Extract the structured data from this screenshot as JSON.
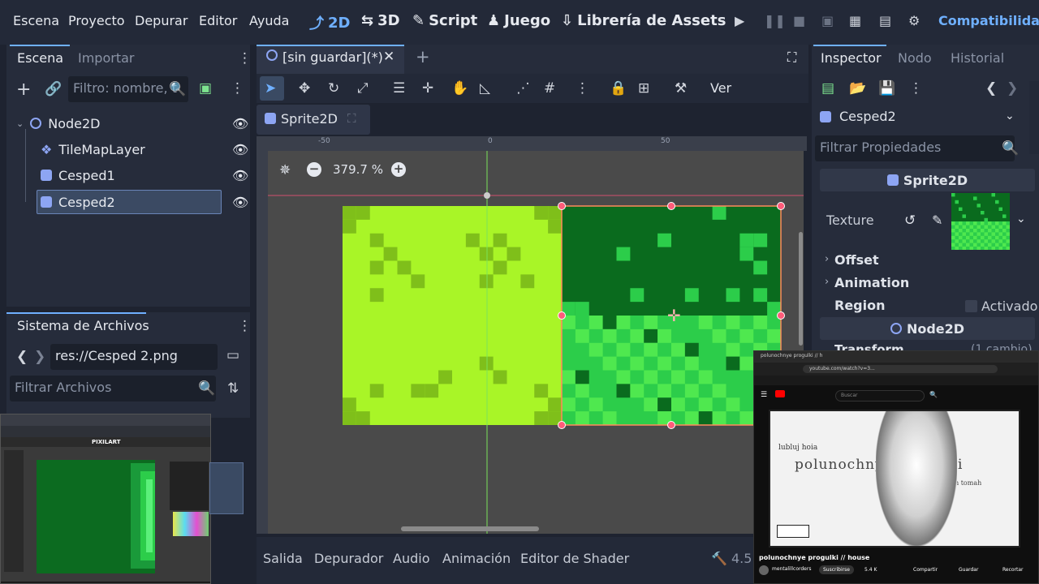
{
  "menu": [
    "Escena",
    "Proyecto",
    "Depurar",
    "Editor",
    "Ayuda"
  ],
  "workspaces": [
    {
      "label": "2D",
      "icon": "2d-icon",
      "active": true
    },
    {
      "label": "3D",
      "icon": "3d-icon",
      "active": false
    },
    {
      "label": "Script",
      "icon": "script-icon",
      "active": false
    },
    {
      "label": "Juego",
      "icon": "game-icon",
      "active": false
    },
    {
      "label": "Librería de Assets",
      "icon": "assetlib-icon",
      "active": false
    }
  ],
  "renderer": "Compatibilidad",
  "scene_panel": {
    "tabs": [
      "Escena",
      "Importar"
    ],
    "filter_placeholder": "Filtro: nombre, t",
    "tree": [
      {
        "name": "Node2D",
        "type": "node2d"
      },
      {
        "name": "TileMapLayer",
        "type": "tilemap"
      },
      {
        "name": "Cesped1",
        "type": "sprite"
      },
      {
        "name": "Cesped2",
        "type": "sprite",
        "selected": true
      }
    ]
  },
  "filesystem": {
    "title": "Sistema de Archivos",
    "path": "res://Cesped 2.png",
    "filter_placeholder": "Filtrar Archivos"
  },
  "editor": {
    "tab_label": "[sin guardar](*)",
    "subtab_label": "Sprite2D",
    "view_label": "Ver",
    "zoom": "379.7 %",
    "ruler_labels": [
      "-50",
      "0",
      "50"
    ]
  },
  "bottom_tabs": [
    "Salida",
    "Depurador",
    "Audio",
    "Animación",
    "Editor de Shader"
  ],
  "version": "4.5.",
  "inspector": {
    "tabs": [
      "Inspector",
      "Nodo",
      "Historial"
    ],
    "node_name": "Cesped2",
    "filter_placeholder": "Filtrar Propiedades",
    "section_sprite": "Sprite2D",
    "texture_label": "Texture",
    "props": [
      "Offset",
      "Animation",
      "Region"
    ],
    "region_value": "Activado",
    "section_node2d": "Node2D",
    "transform_label": "Transform",
    "transform_changes": "(1 cambio)"
  },
  "overlay_youtube": {
    "tab_title": "polunochnye progulki // h",
    "url": "youtube.com/watch?v=3...",
    "search_placeholder": "Buscar",
    "video_title": "polunochnye progulki // house",
    "video_caption_top": "lubluj hoia",
    "video_caption_main": "polunochnye progulki",
    "video_caption_sub": "po beztom tomah",
    "channel": "mentalillcorders",
    "subscribe": "Suscribirse",
    "likes": "5.4 K",
    "share": "Compartir",
    "save": "Guardar",
    "clip": "Recortar"
  },
  "overlay_pixel": {
    "title": "PIXILART"
  },
  "colors": {
    "accent": "#6fb0ff",
    "light_grass": "#a9f527",
    "light_grass_dark": "#7fbf1a",
    "dark_grass": "#0a6b1e",
    "mid_grass": "#2ccd4a",
    "bright_grass": "#4fe84f",
    "handle": "#ff5c7a"
  }
}
